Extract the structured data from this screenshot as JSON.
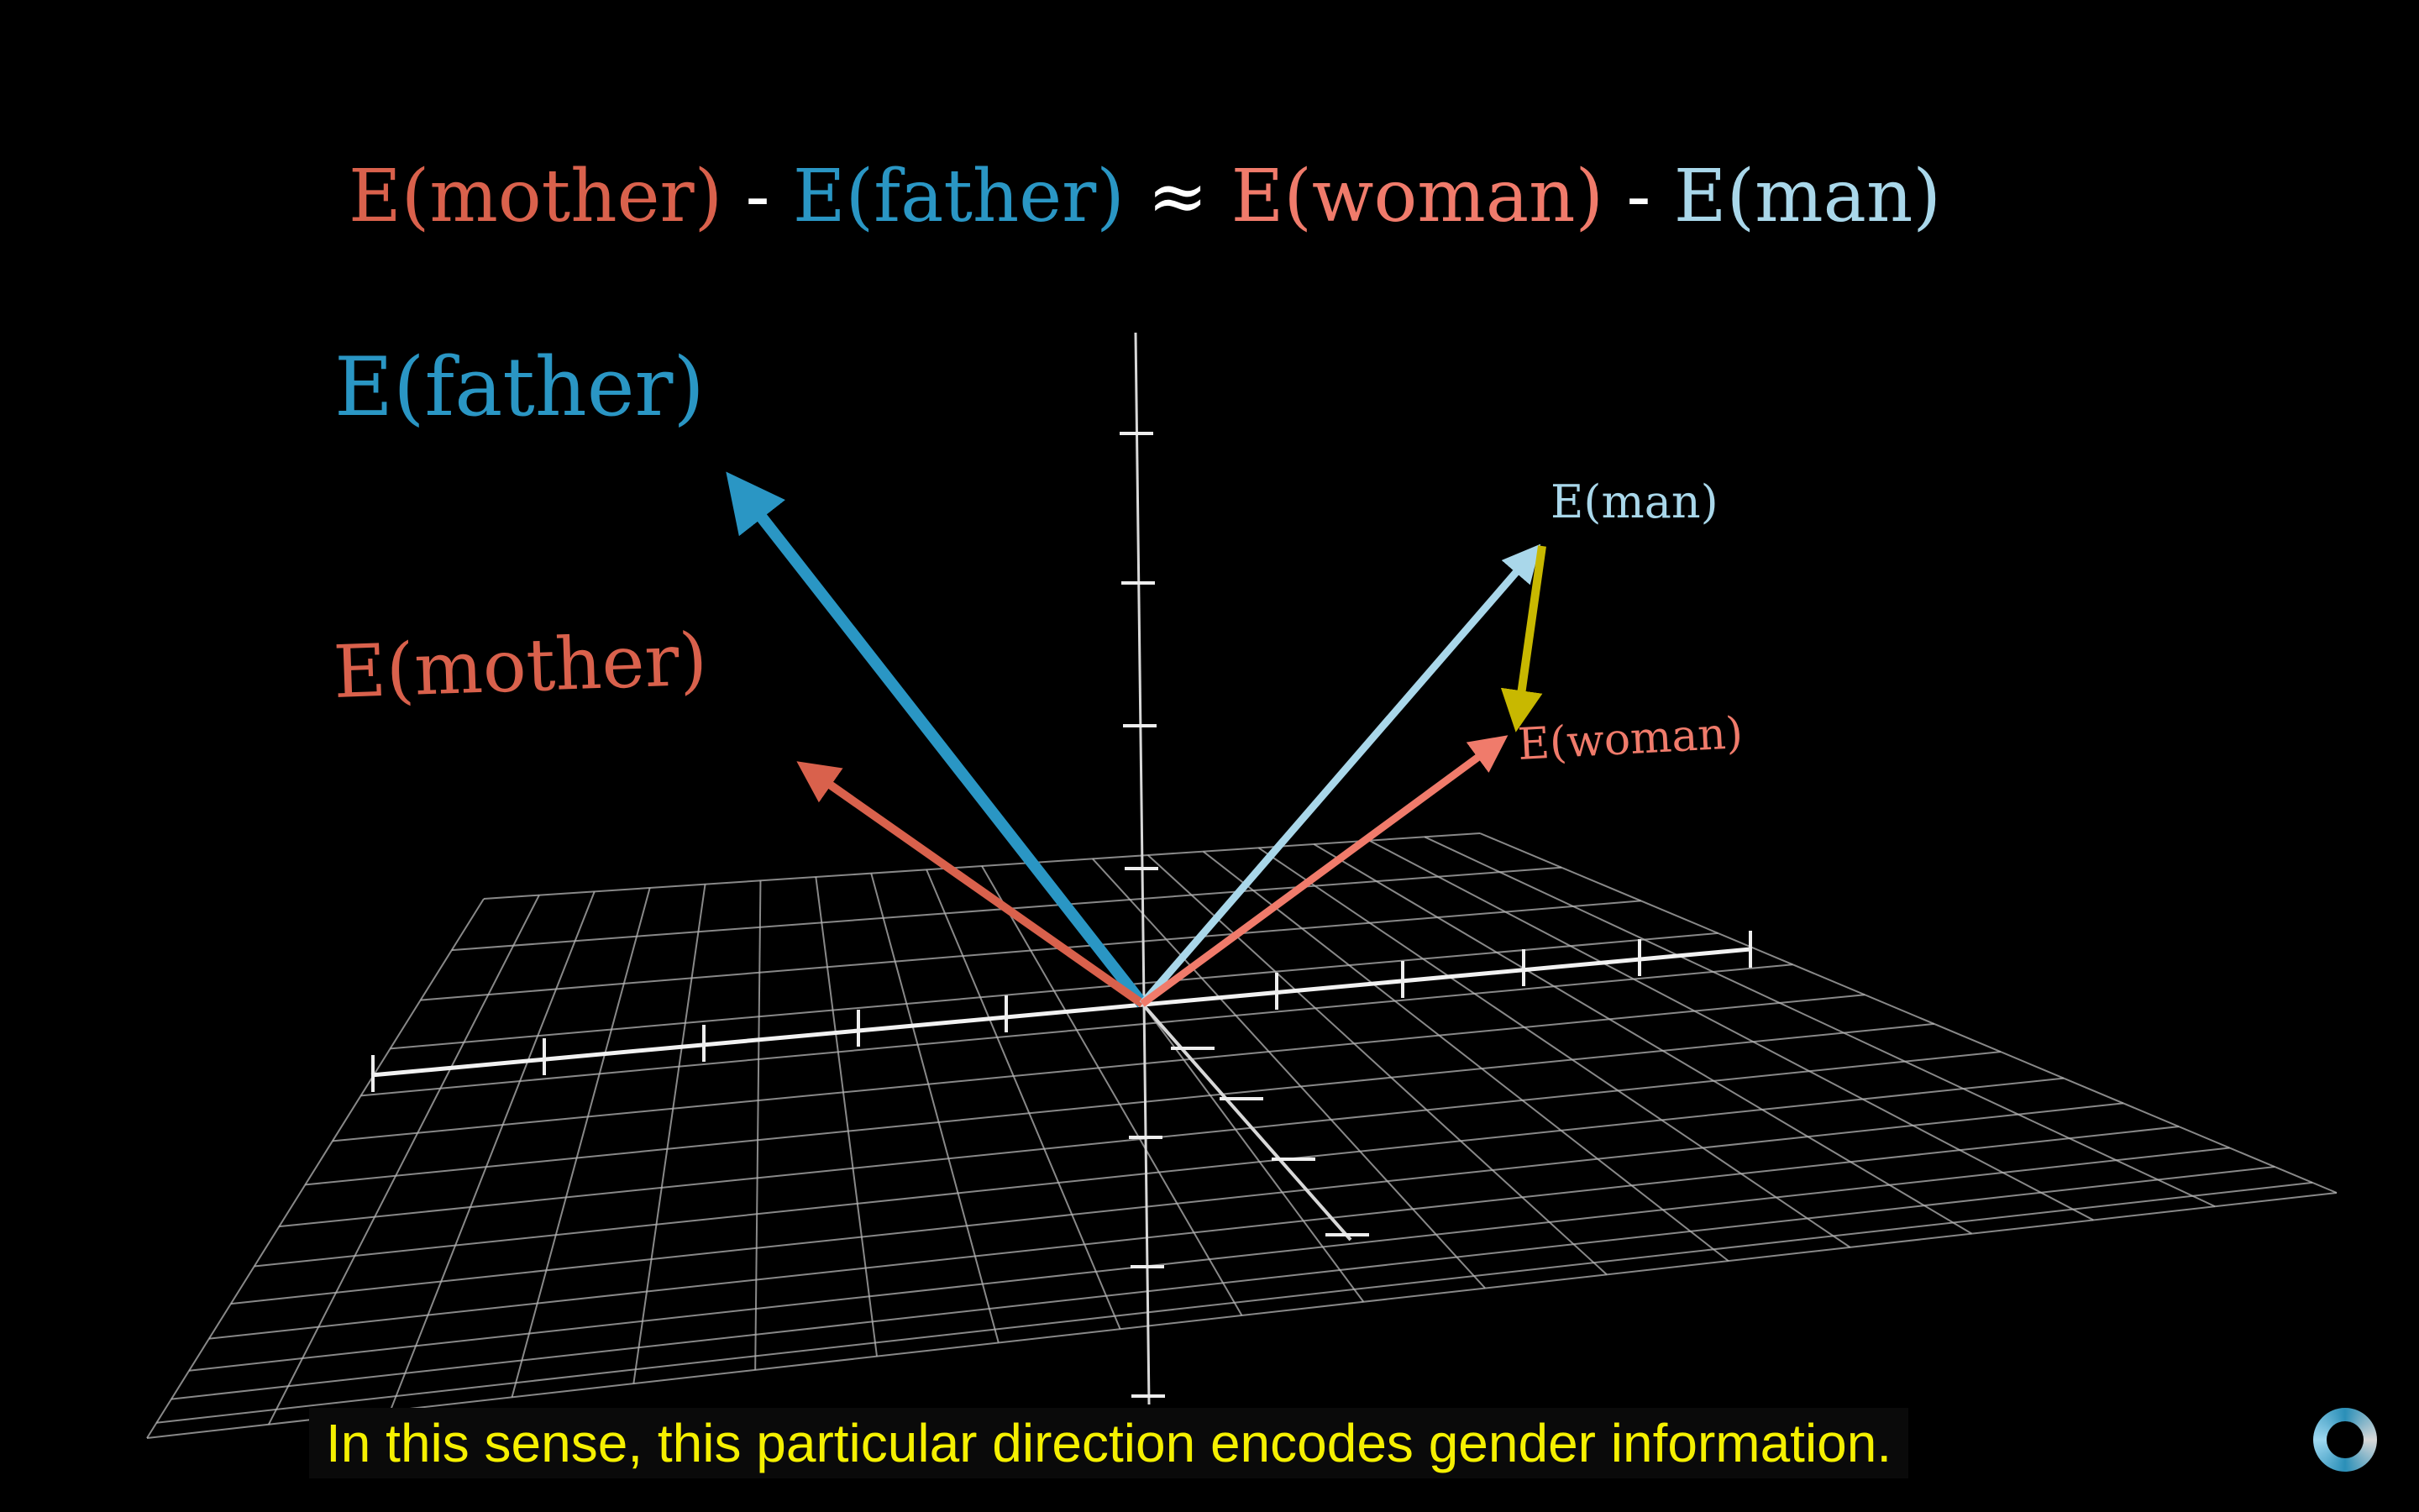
{
  "colors": {
    "mother": "#d9614c",
    "father": "#2a96c4",
    "woman": "#f07b6b",
    "man": "#a9d7ea",
    "diff": "#c8b800",
    "grid": "#b5b5b5",
    "axis": "#f2f2f2",
    "caption": "#f5f000"
  },
  "equation": {
    "t1": "E(mother)",
    "op1": " - ",
    "t2": "E(father)",
    "op2": " ≈ ",
    "t3": "E(woman)",
    "op3": " - ",
    "t4": "E(man)"
  },
  "labels": {
    "father": "E(father)",
    "mother": "E(mother)",
    "man": "E(man)",
    "woman": "E(woman)"
  },
  "vectors": [
    {
      "name": "father",
      "to": "E(father)"
    },
    {
      "name": "mother",
      "to": "E(mother)"
    },
    {
      "name": "man",
      "to": "E(man)"
    },
    {
      "name": "woman",
      "to": "E(woman)"
    },
    {
      "name": "diff",
      "from": "E(man)",
      "to": "E(woman)"
    }
  ],
  "caption": "In this sense, this particular direction encodes gender information.",
  "icons": [
    "loading-spinner-icon"
  ]
}
